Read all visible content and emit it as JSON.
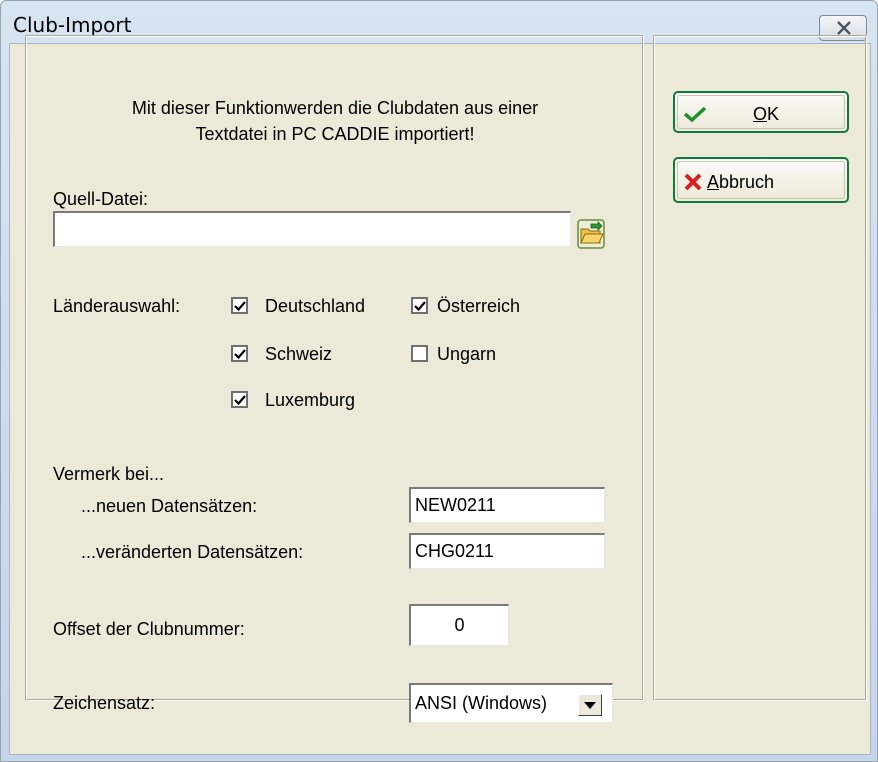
{
  "window": {
    "title": "Club-Import"
  },
  "intro": {
    "line1": "Mit dieser Funktionwerden  die Clubdaten aus einer",
    "line2": "Textdatei in PC CADDIE importiert!"
  },
  "source": {
    "label": "Quell-Datei:",
    "value": ""
  },
  "countries": {
    "label": "Länderauswahl:",
    "items": [
      {
        "label": "Deutschland",
        "checked": true
      },
      {
        "label": "Österreich",
        "checked": true
      },
      {
        "label": "Schweiz",
        "checked": true
      },
      {
        "label": "Ungarn",
        "checked": false
      },
      {
        "label": "Luxemburg",
        "checked": true
      }
    ]
  },
  "note": {
    "label": "Vermerk bei...",
    "new_label": "...neuen Datensätzen:",
    "new_value": "NEW0211",
    "changed_label": "...veränderten Datensätzen:",
    "changed_value": "CHG0211"
  },
  "offset": {
    "label": "Offset der Clubnummer:",
    "value": "0"
  },
  "charset": {
    "label": "Zeichensatz:",
    "value": "ANSI (Windows)"
  },
  "buttons": {
    "ok": {
      "hotkey": "O",
      "rest": "K"
    },
    "cancel": {
      "hotkey": "A",
      "rest": "bbruch"
    }
  },
  "colors": {
    "accent_border": "#0f7a3a",
    "ok_check": "#1f8f2f",
    "cancel_x": "#d42020"
  }
}
